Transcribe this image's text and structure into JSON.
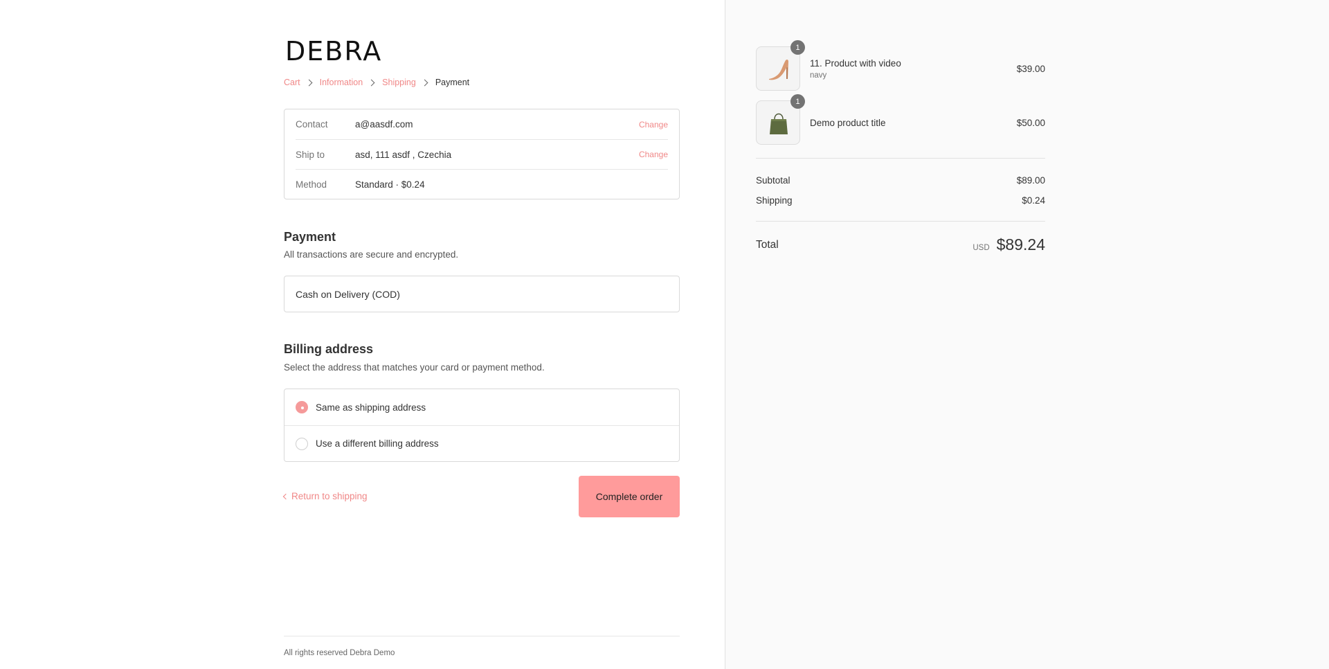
{
  "brand": {
    "logo": "DEBRA"
  },
  "breadcrumb": [
    {
      "label": "Cart"
    },
    {
      "label": "Information"
    },
    {
      "label": "Shipping"
    },
    {
      "label": "Payment"
    }
  ],
  "review": {
    "contact": {
      "label": "Contact",
      "value": "a@aasdf.com",
      "change": "Change"
    },
    "ship_to": {
      "label": "Ship to",
      "value": "asd, 111 asdf , Czechia",
      "change": "Change"
    },
    "method": {
      "label": "Method",
      "value": "Standard · $0.24"
    }
  },
  "payment": {
    "title": "Payment",
    "subtitle": "All transactions are secure and encrypted.",
    "option": "Cash on Delivery (COD)"
  },
  "billing": {
    "title": "Billing address",
    "subtitle": "Select the address that matches your card or payment method.",
    "options": [
      {
        "label": "Same as shipping address",
        "selected": true
      },
      {
        "label": "Use a different billing address",
        "selected": false
      }
    ]
  },
  "actions": {
    "return_label": "Return to shipping",
    "complete_label": "Complete order"
  },
  "footer": {
    "text": "All rights reserved Debra Demo"
  },
  "order_summary": {
    "items": [
      {
        "name": "11. Product with video",
        "variant": "navy",
        "price": "$39.00",
        "quantity": "1",
        "icon": "high-heel-shoe-image"
      },
      {
        "name": "Demo product title",
        "variant": "",
        "price": "$50.00",
        "quantity": "1",
        "icon": "tote-bag-image"
      }
    ],
    "subtotal": {
      "label": "Subtotal",
      "value": "$89.00"
    },
    "shipping": {
      "label": "Shipping",
      "value": "$0.24"
    },
    "total": {
      "label": "Total",
      "currency": "USD",
      "value": "$89.24"
    }
  },
  "colors": {
    "accent": "#f08787",
    "button": "#ff9b9b",
    "sidebar_bg": "#fafafa"
  }
}
